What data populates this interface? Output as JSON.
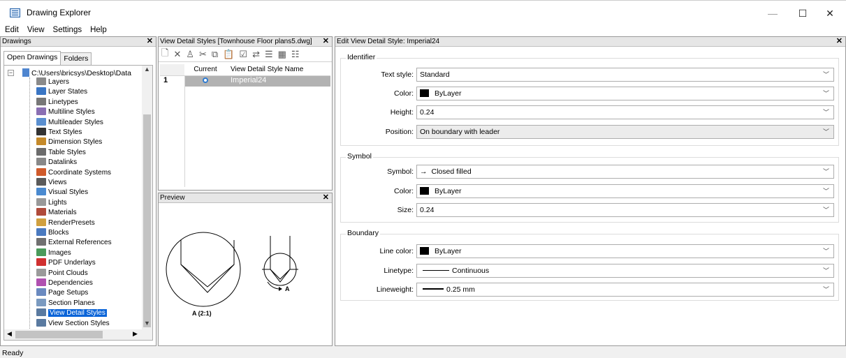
{
  "window": {
    "title": "Drawing Explorer",
    "minimize": "—",
    "maximize": "☐",
    "close": "✕"
  },
  "menu": [
    "Edit",
    "View",
    "Settings",
    "Help"
  ],
  "drawings_panel": {
    "title": "Drawings",
    "tabs": [
      "Open Drawings",
      "Folders"
    ],
    "root": "C:\\Users\\bricsys\\Desktop\\Data",
    "items": [
      {
        "label": "Layers",
        "icon": "layers-icon",
        "color": "#8a8a8a"
      },
      {
        "label": "Layer States",
        "icon": "layer-states-icon",
        "color": "#3a76c4"
      },
      {
        "label": "Linetypes",
        "icon": "linetypes-icon",
        "color": "#777777"
      },
      {
        "label": "Multiline Styles",
        "icon": "multiline-icon",
        "color": "#8a6fb3"
      },
      {
        "label": "Multileader Styles",
        "icon": "multileader-icon",
        "color": "#5a8fd0"
      },
      {
        "label": "Text Styles",
        "icon": "text-styles-icon",
        "color": "#333333"
      },
      {
        "label": "Dimension Styles",
        "icon": "dimension-icon",
        "color": "#c58a2a"
      },
      {
        "label": "Table Styles",
        "icon": "table-icon",
        "color": "#6b6b6b"
      },
      {
        "label": "Datalinks",
        "icon": "datalinks-icon",
        "color": "#888888"
      },
      {
        "label": "Coordinate Systems",
        "icon": "coordinate-icon",
        "color": "#d05a2a"
      },
      {
        "label": "Views",
        "icon": "views-icon",
        "color": "#5a5a5a"
      },
      {
        "label": "Visual Styles",
        "icon": "visual-styles-icon",
        "color": "#4a8ad0"
      },
      {
        "label": "Lights",
        "icon": "lights-icon",
        "color": "#999999"
      },
      {
        "label": "Materials",
        "icon": "materials-icon",
        "color": "#b04a3a"
      },
      {
        "label": "RenderPresets",
        "icon": "render-icon",
        "color": "#d0a040"
      },
      {
        "label": "Blocks",
        "icon": "blocks-icon",
        "color": "#4a7ac0"
      },
      {
        "label": "External References",
        "icon": "xref-icon",
        "color": "#707070"
      },
      {
        "label": "Images",
        "icon": "images-icon",
        "color": "#4a9a5a"
      },
      {
        "label": "PDF Underlays",
        "icon": "pdf-icon",
        "color": "#d03030"
      },
      {
        "label": "Point Clouds",
        "icon": "point-cloud-icon",
        "color": "#9a9a9a"
      },
      {
        "label": "Dependencies",
        "icon": "dependencies-icon",
        "color": "#b050b0"
      },
      {
        "label": "Page Setups",
        "icon": "page-setups-icon",
        "color": "#6a8ac0"
      },
      {
        "label": "Section Planes",
        "icon": "section-planes-icon",
        "color": "#7a9ac0"
      },
      {
        "label": "View Detail Styles",
        "icon": "view-detail-icon",
        "color": "#5a7aa0",
        "selected": true
      },
      {
        "label": "View Section Styles",
        "icon": "view-section-icon",
        "color": "#5a7aa0"
      }
    ]
  },
  "styles_panel": {
    "title": "View Detail Styles [Townhouse Floor plans5.dwg]",
    "columns": [
      "",
      "Current",
      "View Detail Style Name"
    ],
    "rows": [
      {
        "num": "1",
        "name": "Imperial24"
      }
    ]
  },
  "preview_panel": {
    "title": "Preview",
    "label": "A (2:1)",
    "marker": "A"
  },
  "edit_panel": {
    "title": "Edit View Detail Style: Imperial24",
    "identifier": {
      "title": "Identifier",
      "text_style_label": "Text style:",
      "text_style": "Standard",
      "color_label": "Color:",
      "color": "ByLayer",
      "height_label": "Height:",
      "height": "0.24",
      "position_label": "Position:",
      "position": "On boundary with leader"
    },
    "symbol": {
      "title": "Symbol",
      "symbol_label": "Symbol:",
      "symbol": "Closed filled",
      "color_label": "Color:",
      "color": "ByLayer",
      "size_label": "Size:",
      "size": "0.24"
    },
    "boundary": {
      "title": "Boundary",
      "line_color_label": "Line color:",
      "line_color": "ByLayer",
      "linetype_label": "Linetype:",
      "linetype": "Continuous",
      "lineweight_label": "Lineweight:",
      "lineweight": "0.25 mm"
    }
  },
  "status": "Ready"
}
